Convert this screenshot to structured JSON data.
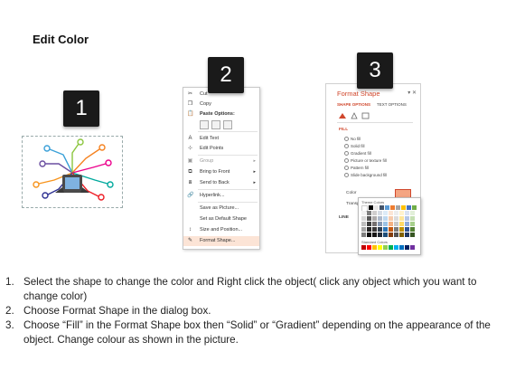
{
  "title": "Edit Color",
  "badges": [
    "1",
    "2",
    "3"
  ],
  "context_menu": {
    "items": [
      {
        "label": "Cut",
        "icon": "scissors-icon"
      },
      {
        "label": "Copy",
        "icon": "copy-icon"
      },
      {
        "label": "Paste Options:",
        "icon": "paste-icon"
      },
      {
        "label": "Edit Text",
        "icon": "edit-text-icon"
      },
      {
        "label": "Edit Points",
        "icon": "edit-points-icon"
      },
      {
        "label": "Group",
        "icon": "group-icon",
        "submenu": true
      },
      {
        "label": "Bring to Front",
        "icon": "bring-front-icon",
        "submenu": true
      },
      {
        "label": "Send to Back",
        "icon": "send-back-icon",
        "submenu": true
      },
      {
        "label": "Hyperlink...",
        "icon": "hyperlink-icon"
      },
      {
        "label": "Save as Picture...",
        "icon": ""
      },
      {
        "label": "Set as Default Shape",
        "icon": ""
      },
      {
        "label": "Size and Position...",
        "icon": "size-position-icon"
      },
      {
        "label": "Format Shape...",
        "icon": "format-shape-icon",
        "selected": true
      }
    ]
  },
  "format_pane": {
    "title": "Format Shape",
    "tabs": [
      "SHAPE OPTIONS",
      "TEXT OPTIONS"
    ],
    "fill_header": "FILL",
    "fill_options": [
      "No fill",
      "Solid fill",
      "Gradient fill",
      "Picture or texture fill",
      "Pattern fill",
      "Slide background fill"
    ],
    "color_label": "Color",
    "transparency_label": "Transp",
    "line_header": "LINE",
    "palette_theme_label": "Theme Colors",
    "palette_standard_label": "Standard Colors"
  },
  "colors": {
    "accent": "#d0472c",
    "badge_bg": "#1a1a1a"
  },
  "steps": [
    {
      "n": "1.",
      "text": "Select the shape to change the color and Right click the object( click any object which you want to change color)"
    },
    {
      "n": "2.",
      "text": "Choose Format Shape in the dialog box."
    },
    {
      "n": "3.",
      "text": "Choose “Fill” in the Format Shape box then “Solid” or “Gradient” depending on the appearance of the object. Change colour as shown in the picture."
    }
  ]
}
